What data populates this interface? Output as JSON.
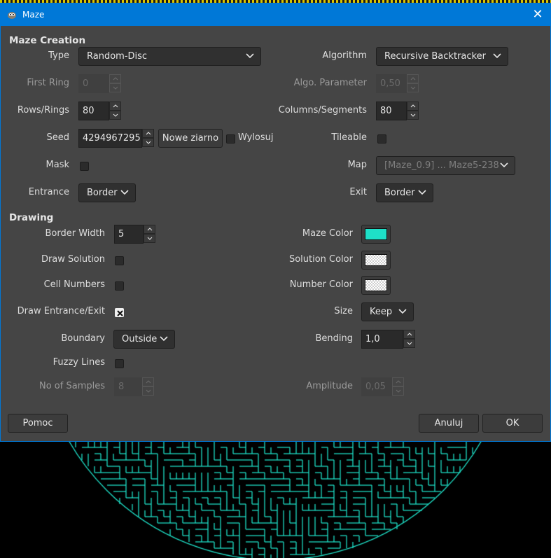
{
  "window": {
    "title": "Maze",
    "close_icon": "close-icon",
    "app_icon": "gimp-icon"
  },
  "creation": {
    "heading": "Maze Creation",
    "type": {
      "label": "Type",
      "value": "Random-Disc"
    },
    "algorithm": {
      "label": "Algorithm",
      "value": "Recursive Backtracker"
    },
    "first_ring": {
      "label": "First Ring",
      "value": "0"
    },
    "algo_param": {
      "label": "Algo. Parameter",
      "value": "0,50"
    },
    "rows": {
      "label": "Rows/Rings",
      "value": "80"
    },
    "columns": {
      "label": "Columns/Segments",
      "value": "80"
    },
    "seed": {
      "label": "Seed",
      "value": "4294967295",
      "new_seed_button": "Nowe ziarno",
      "randomize_label": "Wylosuj",
      "randomize_checked": false
    },
    "tileable": {
      "label": "Tileable",
      "checked": false
    },
    "mask": {
      "label": "Mask",
      "checked": false
    },
    "map": {
      "label": "Map",
      "value": "[Maze_0.9] ... Maze5-238"
    },
    "entrance": {
      "label": "Entrance",
      "value": "Border"
    },
    "exit": {
      "label": "Exit",
      "value": "Border"
    }
  },
  "drawing": {
    "heading": "Drawing",
    "border_width": {
      "label": "Border Width",
      "value": "5"
    },
    "maze_color": {
      "label": "Maze Color",
      "color": "#1ee0c8"
    },
    "draw_solution": {
      "label": "Draw Solution",
      "checked": false
    },
    "solution_color": {
      "label": "Solution Color"
    },
    "cell_numbers": {
      "label": "Cell Numbers",
      "checked": false
    },
    "number_color": {
      "label": "Number Color"
    },
    "draw_entrance_exit": {
      "label": "Draw Entrance/Exit",
      "checked": true
    },
    "size": {
      "label": "Size",
      "value": "Keep"
    },
    "boundary": {
      "label": "Boundary",
      "value": "Outside"
    },
    "bending": {
      "label": "Bending",
      "value": "1,0"
    },
    "fuzzy_lines": {
      "label": "Fuzzy Lines",
      "checked": false
    },
    "samples": {
      "label": "No of Samples",
      "value": "8"
    },
    "amplitude": {
      "label": "Amplitude",
      "value": "0,05"
    }
  },
  "buttons": {
    "help": "Pomoc",
    "cancel": "Anuluj",
    "ok": "OK"
  },
  "colors": {
    "titlebar": "#0078d7",
    "dialog_bg": "#454545",
    "maze_line": "#1ee0c8"
  }
}
